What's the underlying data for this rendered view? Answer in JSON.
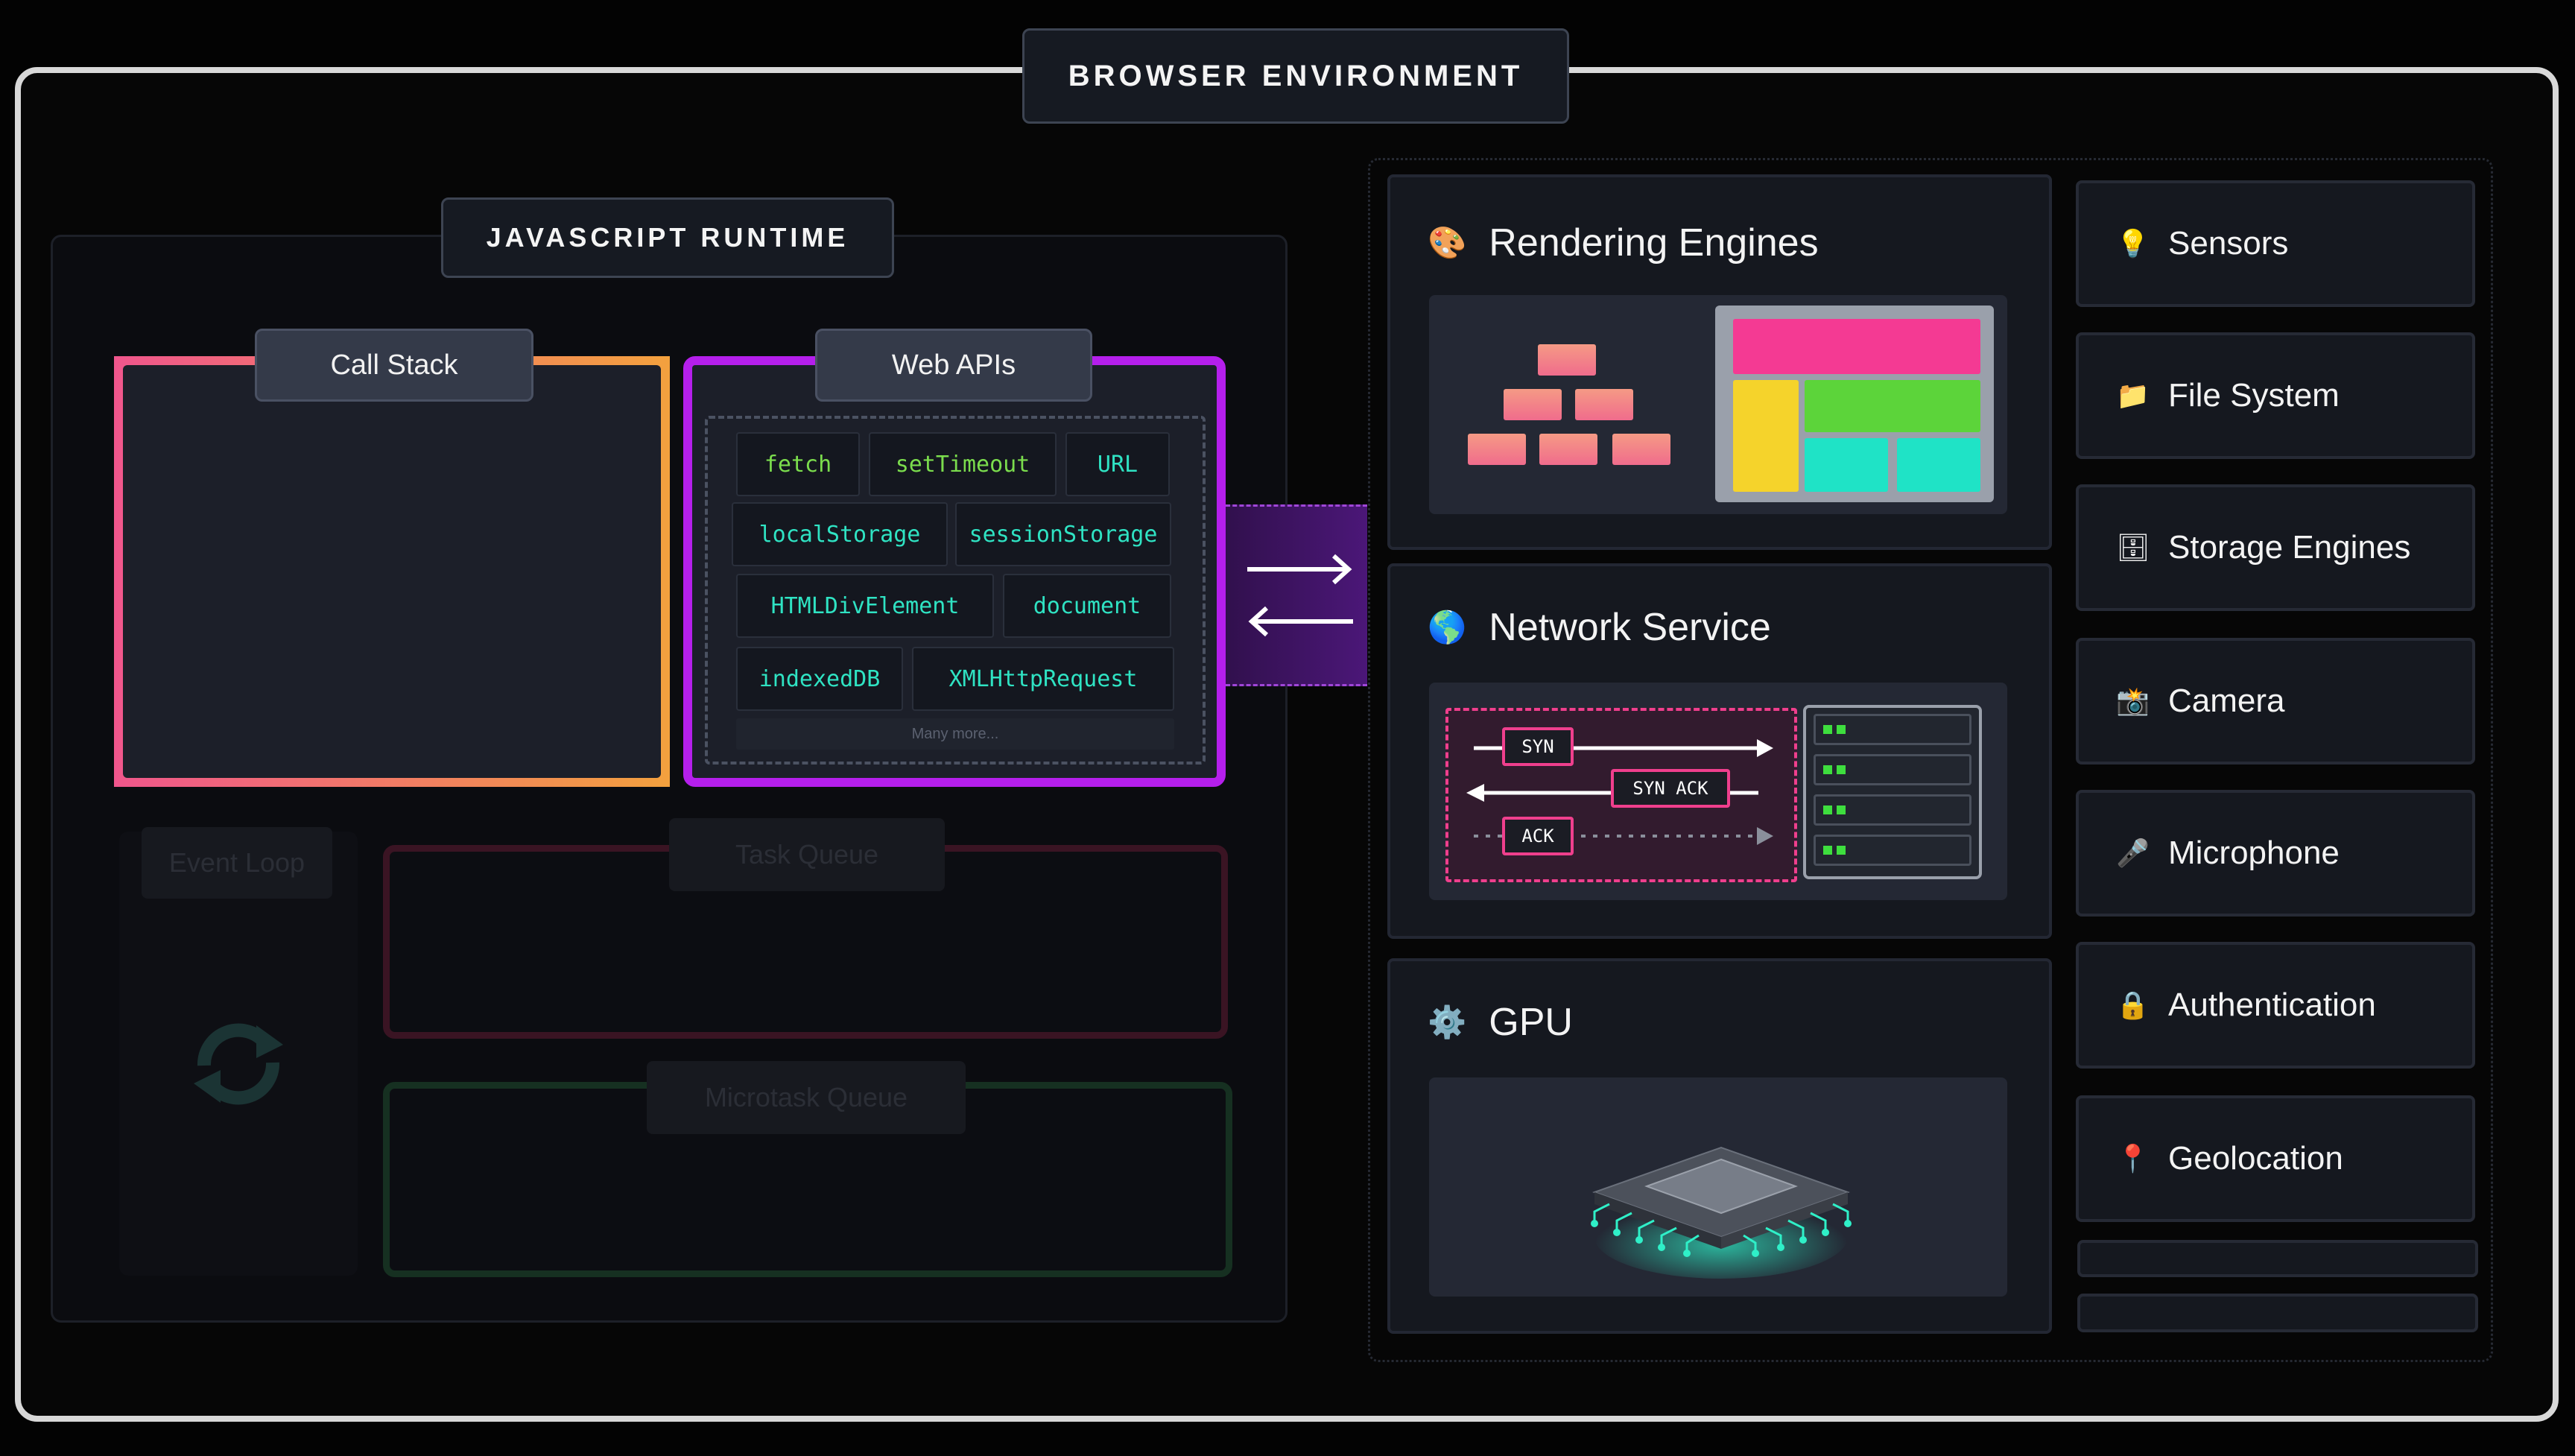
{
  "browser": {
    "title": "BROWSER ENVIRONMENT"
  },
  "runtime": {
    "title": "JAVASCRIPT RUNTIME",
    "call_stack": "Call Stack",
    "web_apis": {
      "title": "Web APIs",
      "items": [
        {
          "label": "fetch",
          "color": "#7bdd4d"
        },
        {
          "label": "setTimeout",
          "color": "#7bdd4d"
        },
        {
          "label": "URL",
          "color": "#2fe3c3"
        },
        {
          "label": "localStorage",
          "color": "#2fe3c3"
        },
        {
          "label": "sessionStorage",
          "color": "#2fe3c3"
        },
        {
          "label": "HTMLDivElement",
          "color": "#2fe3c3"
        },
        {
          "label": "document",
          "color": "#2fe3c3"
        },
        {
          "label": "indexedDB",
          "color": "#2fe3c3"
        },
        {
          "label": "XMLHttpRequest",
          "color": "#2fe3c3"
        }
      ],
      "more": "Many more..."
    },
    "event_loop": "Event Loop",
    "task_queue": "Task Queue",
    "microtask_queue": "Microtask Queue"
  },
  "services": {
    "rendering": {
      "title": "Rendering Engines",
      "icon": "palette-icon"
    },
    "network": {
      "title": "Network Service",
      "icon": "globe-icon",
      "handshake": {
        "syn": "SYN",
        "syn_ack": "SYN ACK",
        "ack": "ACK"
      }
    },
    "gpu": {
      "title": "GPU",
      "icon": "gear-icon"
    }
  },
  "side_items": [
    {
      "label": "Sensors",
      "icon": "lightbulb-icon",
      "glyph": "💡"
    },
    {
      "label": "File System",
      "icon": "folder-icon",
      "glyph": "📁"
    },
    {
      "label": "Storage Engines",
      "icon": "cabinet-icon",
      "glyph": "🗄"
    },
    {
      "label": "Camera",
      "icon": "camera-icon",
      "glyph": "📸"
    },
    {
      "label": "Microphone",
      "icon": "microphone-icon",
      "glyph": "🎤"
    },
    {
      "label": "Authentication",
      "icon": "lock-icon",
      "glyph": "🔒"
    },
    {
      "label": "Geolocation",
      "icon": "pin-icon",
      "glyph": "📍"
    }
  ],
  "colors": {
    "web_apis_border": "#b51fec",
    "call_stack_gradient": [
      "#f0568c",
      "#f3a13e"
    ],
    "task_queue": "#3a1423",
    "microtask_queue": "#163021",
    "network_pink": "#ef3f8d"
  }
}
